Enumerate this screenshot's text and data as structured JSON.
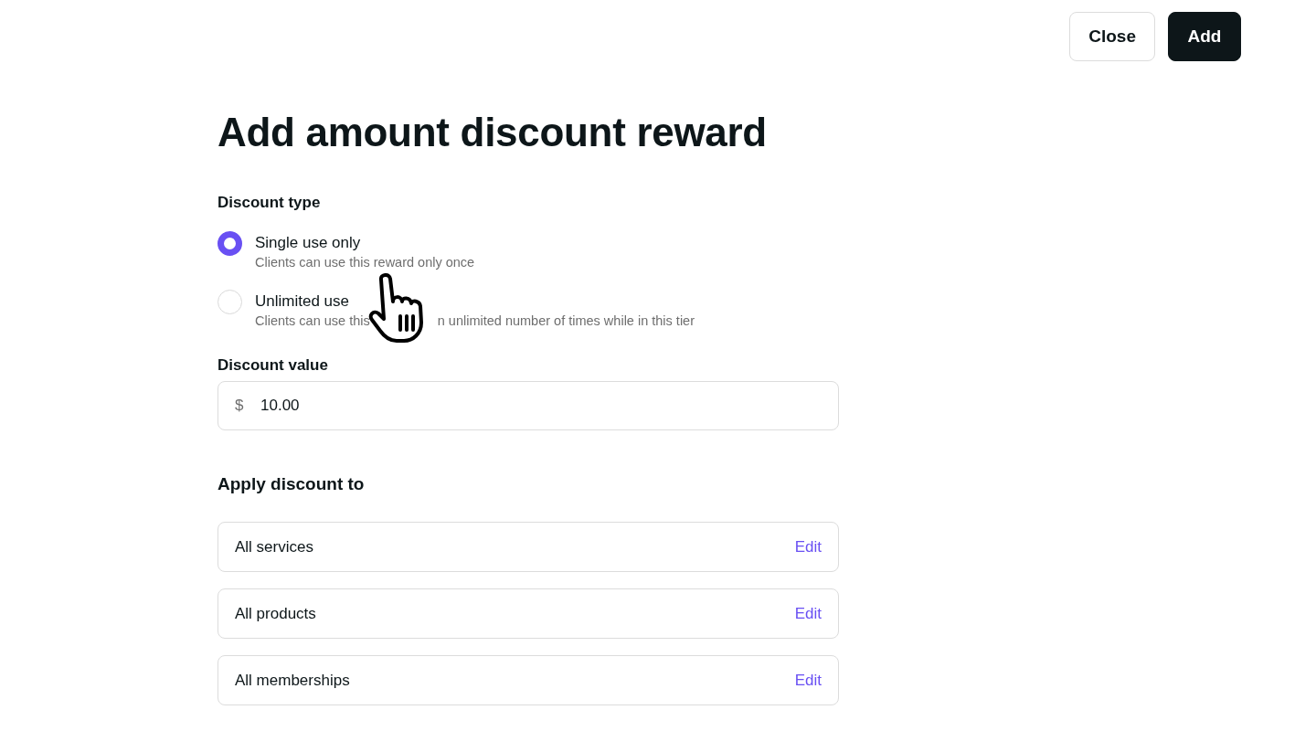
{
  "header": {
    "buttons": [
      {
        "label": "Close",
        "kind": "secondary"
      },
      {
        "label": "Add",
        "kind": "primary"
      }
    ]
  },
  "title": "Add amount discount reward",
  "discount_type": {
    "label": "Discount type",
    "options": [
      {
        "label": "Single use only",
        "description": [
          "Clients can use this reward only once"
        ],
        "selected": true
      },
      {
        "label": "Unlimited use",
        "description": [
          "Clients can use this",
          "n unlimited number of times while in this tier"
        ],
        "selected": false
      }
    ]
  },
  "discount_value": {
    "label": "Discount value",
    "prefix": "$",
    "value": "10.00"
  },
  "apply_discount": {
    "heading": "Apply discount to",
    "rows": [
      {
        "label": "All services",
        "action": "Edit"
      },
      {
        "label": "All products",
        "action": "Edit"
      },
      {
        "label": "All memberships",
        "action": "Edit"
      }
    ]
  }
}
